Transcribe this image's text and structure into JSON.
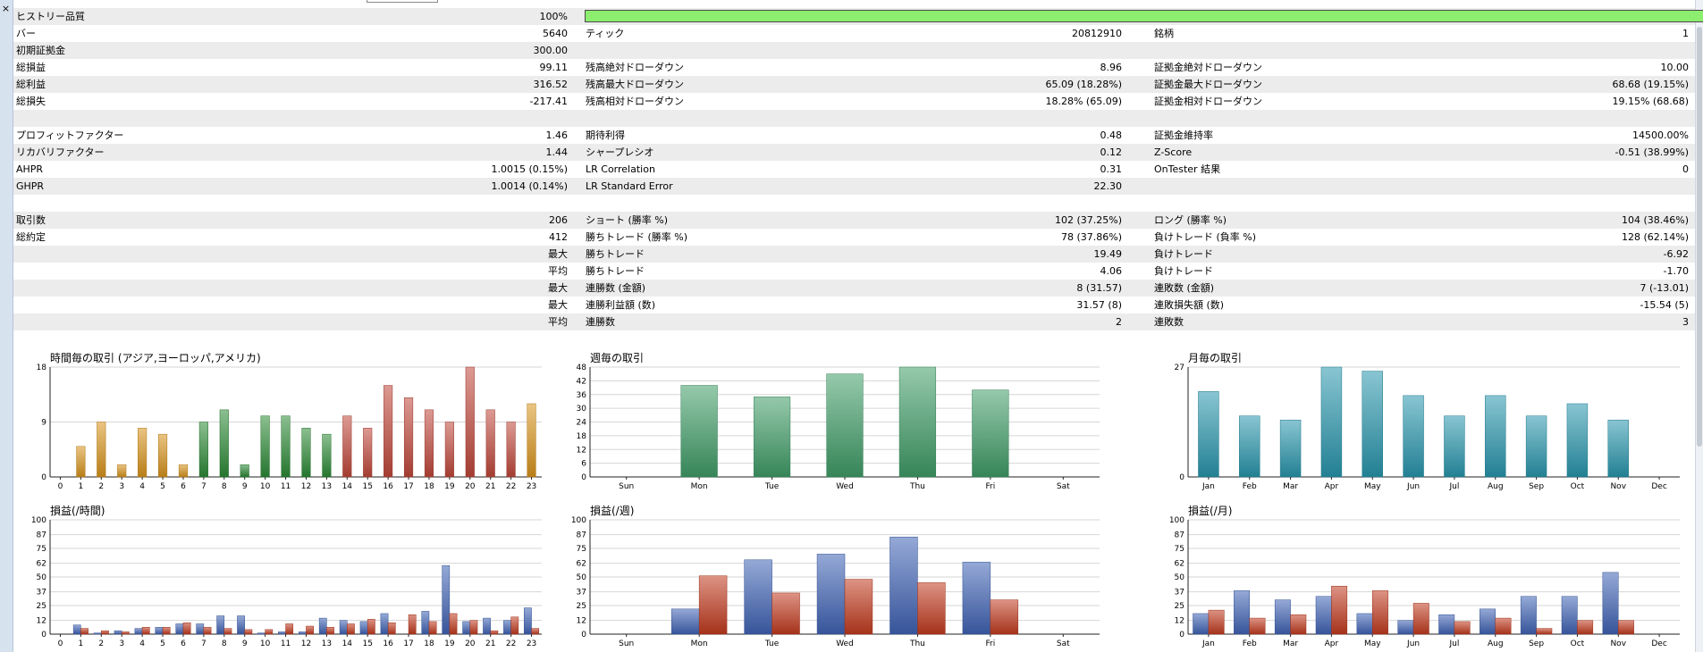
{
  "colors": {
    "quality_bar": "#8ced6e",
    "row_alt": "#ececec",
    "asia": "#d8941c",
    "europe": "#2c8a36",
    "america": "#c0473a",
    "week_bar": "#3f9d67",
    "month_bar": "#2896ad",
    "profit": "#3f63b5",
    "loss": "#c23b1f",
    "grid": "#d6d6d6",
    "axis": "#222222"
  },
  "icons": {
    "close": "close-icon"
  },
  "close_glyph": "×",
  "report": {
    "rows": [
      {
        "l1": "ヒストリー品質",
        "v1": "100%",
        "bar": true
      },
      {
        "l1": "バー",
        "v1": "5640",
        "l2": "ティック",
        "v2": "20812910",
        "l3": "銘柄",
        "v3": "1"
      },
      {
        "l1": "初期証拠金",
        "v1": "300.00"
      },
      {
        "l1": "総損益",
        "v1": "99.11",
        "l2": "残高絶対ドローダウン",
        "v2": "8.96",
        "l3": "証拠金絶対ドローダウン",
        "v3": "10.00"
      },
      {
        "l1": "総利益",
        "v1": "316.52",
        "l2": "残高最大ドローダウン",
        "v2": "65.09 (18.28%)",
        "l3": "証拠金最大ドローダウン",
        "v3": "68.68 (19.15%)"
      },
      {
        "l1": "総損失",
        "v1": "-217.41",
        "l2": "残高相対ドローダウン",
        "v2": "18.28% (65.09)",
        "l3": "証拠金相対ドローダウン",
        "v3": "19.15% (68.68)"
      },
      {},
      {
        "l1": "プロフィットファクター",
        "v1": "1.46",
        "l2": "期待利得",
        "v2": "0.48",
        "l3": "証拠金維持率",
        "v3": "14500.00%"
      },
      {
        "l1": "リカバリファクター",
        "v1": "1.44",
        "l2": "シャープレシオ",
        "v2": "0.12",
        "l3": "Z-Score",
        "v3": "-0.51 (38.99%)"
      },
      {
        "l1": "AHPR",
        "v1": "1.0015 (0.15%)",
        "l2": "LR Correlation",
        "v2": "0.31",
        "l3": "OnTester 結果",
        "v3": "0"
      },
      {
        "l1": "GHPR",
        "v1": "1.0014 (0.14%)",
        "l2": "LR Standard Error",
        "v2": "22.30"
      },
      {},
      {
        "l1": "取引数",
        "v1": "206",
        "l2": "ショート (勝率 %)",
        "v2": "102 (37.25%)",
        "l3": "ロング (勝率 %)",
        "v3": "104 (38.46%)"
      },
      {
        "l1": "総約定",
        "v1": "412",
        "l2": "勝ちトレード (勝率 %)",
        "v2": "78 (37.86%)",
        "l3": "負けトレード (負率 %)",
        "v3": "128 (62.14%)"
      },
      {
        "v1": "最大",
        "l2": "勝ちトレード",
        "v2": "19.49",
        "l3": "負けトレード",
        "v3": "-6.92"
      },
      {
        "v1": "平均",
        "l2": "勝ちトレード",
        "v2": "4.06",
        "l3": "負けトレード",
        "v3": "-1.70"
      },
      {
        "v1": "最大",
        "l2": "連勝数 (金額)",
        "v2": "8 (31.57)",
        "l3": "連敗数 (金額)",
        "v3": "7 (-13.01)"
      },
      {
        "v1": "最大",
        "l2": "連勝利益額 (数)",
        "v2": "31.57 (8)",
        "l3": "連敗損失額 (数)",
        "v3": "-15.54 (5)"
      },
      {
        "v1": "平均",
        "l2": "連勝数",
        "v2": "2",
        "l3": "連敗数",
        "v3": "3"
      },
      {}
    ]
  },
  "chart_data": [
    {
      "id": "hourly-trades",
      "type": "bar",
      "title": "時間毎の取引 (アジア,ヨーロッパ,アメリカ)",
      "categories": [
        "0",
        "1",
        "2",
        "3",
        "4",
        "5",
        "6",
        "7",
        "8",
        "9",
        "10",
        "11",
        "12",
        "13",
        "14",
        "15",
        "16",
        "17",
        "18",
        "19",
        "20",
        "21",
        "22",
        "23"
      ],
      "values": [
        0,
        5,
        9,
        2,
        8,
        7,
        2,
        9,
        11,
        2,
        10,
        10,
        8,
        7,
        10,
        8,
        15,
        13,
        11,
        9,
        18,
        11,
        9,
        12
      ],
      "session_colors": [
        "asia",
        "asia",
        "asia",
        "asia",
        "asia",
        "asia",
        "asia",
        "europe",
        "europe",
        "europe",
        "europe",
        "europe",
        "europe",
        "europe",
        "america",
        "america",
        "america",
        "america",
        "america",
        "america",
        "america",
        "america",
        "america",
        "asia"
      ],
      "yticks": [
        "0",
        "9",
        "18"
      ],
      "ylim": [
        0,
        18
      ]
    },
    {
      "id": "weekday-trades",
      "type": "bar",
      "title": "週毎の取引",
      "categories": [
        "Sun",
        "Mon",
        "Tue",
        "Wed",
        "Thu",
        "Fri",
        "Sat"
      ],
      "values": [
        0,
        40,
        35,
        45,
        48,
        38,
        0
      ],
      "yticks": [
        "0",
        "6",
        "12",
        "18",
        "24",
        "30",
        "36",
        "42",
        "48"
      ],
      "ylim": [
        0,
        48
      ]
    },
    {
      "id": "monthly-trades",
      "type": "bar",
      "title": "月毎の取引",
      "categories": [
        "Jan",
        "Feb",
        "Mar",
        "Apr",
        "May",
        "Jun",
        "Jul",
        "Aug",
        "Sep",
        "Oct",
        "Nov",
        "Dec"
      ],
      "values": [
        21,
        15,
        14,
        27,
        26,
        20,
        15,
        20,
        15,
        18,
        14,
        0
      ],
      "yticks": [
        "0",
        "27"
      ],
      "ylim": [
        0,
        27
      ]
    },
    {
      "id": "hourly-pnl",
      "type": "bar",
      "title": "損益(/時間)",
      "categories": [
        "0",
        "1",
        "2",
        "3",
        "4",
        "5",
        "6",
        "7",
        "8",
        "9",
        "10",
        "11",
        "12",
        "13",
        "14",
        "15",
        "16",
        "17",
        "18",
        "19",
        "20",
        "21",
        "22",
        "23"
      ],
      "series": [
        {
          "values": [
            0,
            8,
            1,
            3,
            5,
            6,
            9,
            9,
            16,
            16,
            1,
            2,
            2,
            14,
            12,
            11,
            18,
            0,
            20,
            60,
            11,
            14,
            12,
            23
          ]
        },
        {
          "values": [
            0,
            5,
            3,
            2,
            6,
            6,
            10,
            6,
            5,
            4,
            4,
            9,
            7,
            6,
            9,
            13,
            10,
            17,
            11,
            18,
            12,
            3,
            15,
            5
          ]
        }
      ],
      "yticks": [
        "0",
        "12",
        "25",
        "37",
        "50",
        "62",
        "75",
        "87",
        "100"
      ],
      "ylim": [
        0,
        100
      ]
    },
    {
      "id": "weekday-pnl",
      "type": "bar",
      "title": "損益(/週)",
      "categories": [
        "Sun",
        "Mon",
        "Tue",
        "Wed",
        "Thu",
        "Fri",
        "Sat"
      ],
      "series": [
        {
          "values": [
            0,
            22,
            65,
            70,
            85,
            63,
            0
          ]
        },
        {
          "values": [
            0,
            51,
            36,
            48,
            45,
            30,
            0
          ]
        }
      ],
      "yticks": [
        "0",
        "12",
        "25",
        "37",
        "50",
        "62",
        "75",
        "87",
        "100"
      ],
      "ylim": [
        0,
        100
      ]
    },
    {
      "id": "monthly-pnl",
      "type": "bar",
      "title": "損益(/月)",
      "categories": [
        "Jan",
        "Feb",
        "Mar",
        "Apr",
        "May",
        "Jun",
        "Jul",
        "Aug",
        "Sep",
        "Oct",
        "Nov",
        "Dec"
      ],
      "series": [
        {
          "values": [
            18,
            38,
            30,
            33,
            18,
            12,
            17,
            22,
            33,
            33,
            54,
            0
          ]
        },
        {
          "values": [
            21,
            14,
            17,
            42,
            38,
            27,
            11,
            14,
            5,
            12,
            12,
            0
          ]
        }
      ],
      "yticks": [
        "0",
        "12",
        "25",
        "37",
        "50",
        "62",
        "75",
        "87",
        "100"
      ],
      "ylim": [
        0,
        100
      ]
    }
  ]
}
